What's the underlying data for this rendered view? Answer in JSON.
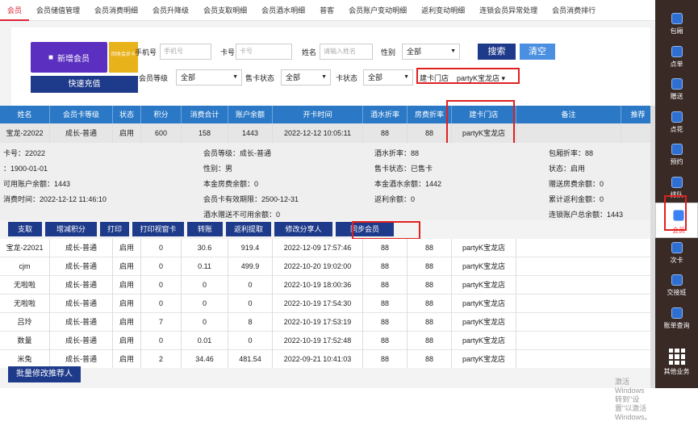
{
  "tabs": [
    "会员",
    "会员储值管理",
    "会员消费明细",
    "会员升降级",
    "会员支取明细",
    "会员酒水明细",
    "普客",
    "会员账户变动明细",
    "返利变动明细",
    "连锁会员异常处理",
    "会员消费排行"
  ],
  "buttons": {
    "new_member": "新增会员",
    "recycle": "回收会员卡",
    "recharge": "快速充值",
    "search": "搜索",
    "clear": "清空",
    "batch": "批量修改推荐人"
  },
  "filters": {
    "phone_label": "手机号",
    "phone_placeholder": "手机号",
    "card_label": "卡号",
    "card_placeholder": "卡号",
    "name_label": "姓名",
    "name_placeholder": "请输入姓名",
    "gender_label": "性别",
    "gender_value": "全部",
    "level_label": "会员等级",
    "level_value": "全部",
    "sale_label": "售卡状态",
    "sale_value": "全部",
    "cardstate_label": "卡状态",
    "cardstate_value": "全部",
    "store_label": "建卡门店",
    "store_value": "partyK宝龙店"
  },
  "columns": [
    "姓名",
    "会员卡等级",
    "状态",
    "积分",
    "消费合计",
    "账户余额",
    "开卡时间",
    "酒水折率",
    "房费折率",
    "建卡门店",
    "备注",
    "推荐"
  ],
  "selected": [
    "宝龙-22022",
    "成长-普通",
    "启用",
    "600",
    "158",
    "1443",
    "2022-12-12 10:05:11",
    "88",
    "88",
    "partyK宝龙店",
    ""
  ],
  "details": {
    "card": "卡号：22022",
    "birthday": "：1900-01-01",
    "avail": "可用账户余额：1443",
    "lastuse": "消费时间：2022-12-12 11:46:10",
    "level": "会员等级：成长-普通",
    "gender": "性别：男",
    "room_bal": "本金房费余额：0",
    "valid": "会员卡有效期限：2500-12-31",
    "wine_bal": "酒水赠送不可用余额：0",
    "wine_rate": "酒水折率：88",
    "sale_state": "售卡状态：已售卡",
    "wine_principal": "本金酒水余额：1442",
    "rebate": "返利余额：0",
    "room_rate": "包厢折率：88",
    "state": "状态：启用",
    "gift_room": "赠送房费余额：0",
    "total_rebate": "累计返利金额：0",
    "chain_total": "连锁账户总余额：1443"
  },
  "actions": [
    "支取",
    "增减积分",
    "打印",
    "打印视窗卡",
    "转账",
    "返利提取",
    "修改分享人",
    "同步会员"
  ],
  "rows": [
    [
      "宝龙-22021",
      "成长-普通",
      "启用",
      "0",
      "30.6",
      "919.4",
      "2022-12-09 17:57:46",
      "88",
      "88",
      "partyK宝龙店"
    ],
    [
      "cjm",
      "成长-普通",
      "启用",
      "0",
      "0.11",
      "499.9",
      "2022-10-20 19:02:00",
      "88",
      "88",
      "partyK宝龙店"
    ],
    [
      "无啦啦",
      "成长-普通",
      "启用",
      "0",
      "0",
      "0",
      "2022-10-19 18:00:36",
      "88",
      "88",
      "partyK宝龙店"
    ],
    [
      "无啦啦",
      "成长-普通",
      "启用",
      "0",
      "0",
      "0",
      "2022-10-19 17:54:30",
      "88",
      "88",
      "partyK宝龙店"
    ],
    [
      "吕玲",
      "成长-普通",
      "启用",
      "7",
      "0",
      "8",
      "2022-10-19 17:53:19",
      "88",
      "88",
      "partyK宝龙店"
    ],
    [
      "数量",
      "成长-普通",
      "启用",
      "0",
      "0.01",
      "0",
      "2022-10-19 17:52:48",
      "88",
      "88",
      "partyK宝龙店"
    ],
    [
      "米兔",
      "成长-普通",
      "启用",
      "2",
      "34.46",
      "481.54",
      "2022-09-21 10:41:03",
      "88",
      "88",
      "partyK宝龙店"
    ]
  ],
  "watermark": [
    "激活 Windows",
    "转到\"设置\"以激活 Windows。"
  ],
  "sidebar": [
    "包厢",
    "点单",
    "赠送",
    "点花",
    "预约",
    "排队",
    "会员",
    "次卡",
    "交接班",
    "账单查询",
    "其他业务"
  ]
}
